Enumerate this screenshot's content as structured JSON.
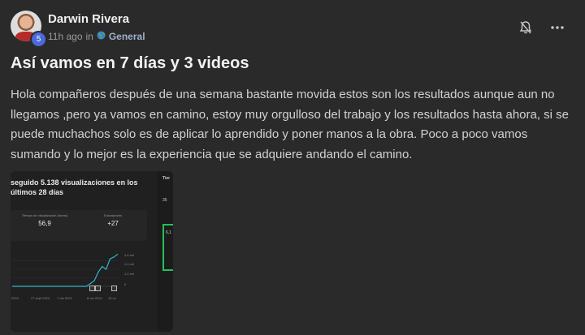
{
  "post": {
    "author": "Darwin Rivera",
    "level": "5",
    "time": "11h ago",
    "in_word": "in",
    "category_icon": "globe-icon",
    "category": "General",
    "title": "Así vamos en 7 días y 3 videos",
    "body": "Hola compañeros después de una semana bastante movida estos son los resultados aunque aun no llegamos ,pero ya vamos en camino, estoy muy orgulloso del trabajo y los resultados hasta ahora, si se puede muchachos solo es de aplicar lo aprendido y poner manos a la obra. Poco a poco vamos sumando y lo mejor es la experiencia que se adquiere andando el camino."
  },
  "thumbnail": {
    "title": "seguido 5.138 visualizaciones en los últimos 28 días",
    "stats": [
      {
        "label": "Tiempo de visualización (horas)",
        "value": "56,9"
      },
      {
        "label": "Suscriptores",
        "value": "+27"
      }
    ],
    "y_labels": [
      "3,6 mil",
      "2,4 mil",
      "1,2 mil",
      "0"
    ],
    "x_labels": [
      "2024",
      "27 sept 2024",
      "7 oct 2024",
      "8 oct 2024",
      "15 oc"
    ],
    "side": {
      "title": "Tier",
      "value_1": "35",
      "value_2": "6,1"
    },
    "line_color": "#2fb6c9",
    "chart_data": {
      "type": "line",
      "ylim": [
        0,
        3600
      ],
      "values": [
        0,
        0,
        0,
        0,
        0,
        0,
        0,
        0,
        0,
        0,
        0,
        0,
        0,
        0,
        0,
        0,
        0,
        0,
        0,
        0,
        300,
        600,
        1500,
        2100,
        1800,
        2900,
        3100,
        3400
      ]
    }
  },
  "colors": {
    "accent_badge": "#4a6ad8",
    "highlight_box": "#25c05a"
  }
}
